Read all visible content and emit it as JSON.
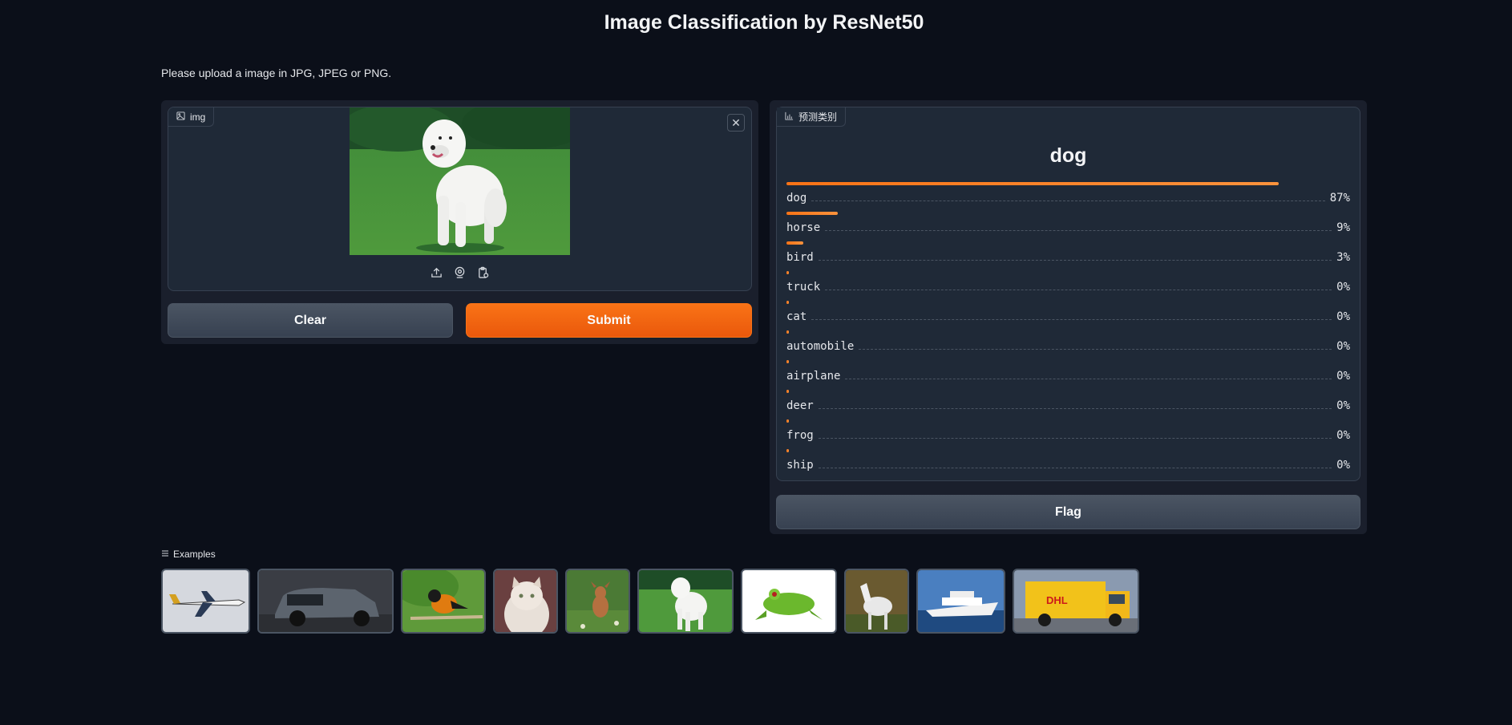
{
  "page": {
    "title": "Image Classification by ResNet50",
    "description": "Please upload a image in JPG, JPEG or PNG."
  },
  "input": {
    "label": "img",
    "icon": "image-icon",
    "tools": [
      "upload-icon",
      "webcam-icon",
      "clipboard-icon"
    ],
    "close_icon": "close-icon"
  },
  "buttons": {
    "clear": "Clear",
    "submit": "Submit",
    "flag": "Flag"
  },
  "output": {
    "label": "预测类别",
    "icon": "bar-chart-icon",
    "predicted": "dog",
    "confidences": [
      {
        "label": "dog",
        "value": 0.87,
        "display": "87%"
      },
      {
        "label": "horse",
        "value": 0.09,
        "display": "9%"
      },
      {
        "label": "bird",
        "value": 0.03,
        "display": "3%"
      },
      {
        "label": "truck",
        "value": 0.0,
        "display": "0%"
      },
      {
        "label": "cat",
        "value": 0.0,
        "display": "0%"
      },
      {
        "label": "automobile",
        "value": 0.0,
        "display": "0%"
      },
      {
        "label": "airplane",
        "value": 0.0,
        "display": "0%"
      },
      {
        "label": "deer",
        "value": 0.0,
        "display": "0%"
      },
      {
        "label": "frog",
        "value": 0.0,
        "display": "0%"
      },
      {
        "label": "ship",
        "value": 0.0,
        "display": "0%"
      }
    ]
  },
  "examples": {
    "label": "Examples",
    "icon": "list-icon",
    "items": [
      "airplane",
      "automobile",
      "bird",
      "cat",
      "deer",
      "dog",
      "frog",
      "horse",
      "ship",
      "truck"
    ]
  },
  "colors": {
    "accent": "#f97316",
    "background": "#0b0f19",
    "panel": "#1f2937"
  }
}
